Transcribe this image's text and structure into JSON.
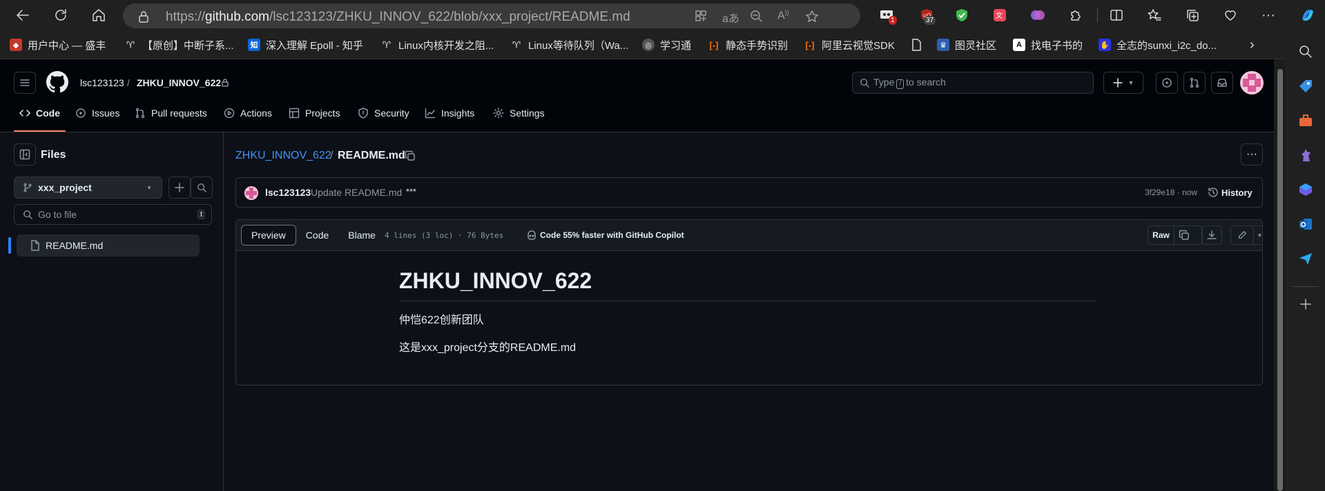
{
  "browser": {
    "url_prefix": "https://",
    "url_domain": "github.com",
    "url_path": "/lsc123123/ZHKU_INNOV_622/blob/xxx_project/README.md",
    "extensions": [
      {
        "icon": "pc-extension-icon",
        "badge": "1",
        "color": "#e5e5e5",
        "badge_color": "#d02020"
      },
      {
        "icon": "ublock-icon",
        "badge": "37",
        "color": "#b3261e",
        "badge_color": "#444444"
      },
      {
        "icon": "shield-check-icon",
        "badge": "",
        "color": "#3fb950"
      },
      {
        "icon": "translate-icon",
        "badge": "",
        "color": "#e8455a"
      },
      {
        "icon": "brain-icon",
        "badge": "",
        "color": "#8a63d2"
      }
    ],
    "bookmarks": [
      {
        "label": "用户中心 — 盛丰",
        "icon": "bookmark-favicon-1",
        "color": "#c0392b"
      },
      {
        "label": "【原创】中断子系...",
        "icon": "wowo-icon",
        "color": "#202020"
      },
      {
        "label": "深入理解 Epoll - 知乎",
        "icon": "zhihu-icon",
        "color": "#0a66d8",
        "glyph": "知"
      },
      {
        "label": "Linux内核开发之阻...",
        "icon": "wowo-icon",
        "color": "#202020"
      },
      {
        "label": "Linux等待队列（Wa...",
        "icon": "wowo-icon",
        "color": "#202020"
      },
      {
        "label": "学习通",
        "icon": "xuexitong-icon",
        "color": "#555555"
      },
      {
        "label": "静态手势识别",
        "icon": "aliyun-icon",
        "color": "#202020"
      },
      {
        "label": "阿里云视觉SDK",
        "icon": "aliyun-icon",
        "color": "#202020"
      },
      {
        "label": "",
        "icon": "page-icon",
        "color": "#202020"
      },
      {
        "label": "图灵社区",
        "icon": "turing-icon",
        "color": "#2d5fb0"
      },
      {
        "label": "找电子书的",
        "icon": "letter-a-icon",
        "color": "#ffffff",
        "glyph": "A"
      },
      {
        "label": "全志的sunxi_i2c_do...",
        "icon": "baidu-icon",
        "color": "#2932e1"
      }
    ]
  },
  "github": {
    "owner": "lsc123123",
    "sep": "/",
    "repo": "ZHKU_INNOV_622",
    "search_prefix": "Type",
    "search_key": "/",
    "search_suffix": "to search",
    "tabs": [
      "Code",
      "Issues",
      "Pull requests",
      "Actions",
      "Projects",
      "Security",
      "Insights",
      "Settings"
    ],
    "sidebar": {
      "title": "Files",
      "branch": "xxx_project",
      "goto_placeholder": "Go to file",
      "goto_key": "t",
      "file": "README.md"
    },
    "path": {
      "repo": "ZHKU_INNOV_622",
      "sep": "/",
      "file": "README.md"
    },
    "commit": {
      "author": "lsc123123",
      "message": "Update README.md",
      "sha_time": "3f29e18 · now",
      "history": "History"
    },
    "file_toolbar": {
      "views": [
        "Preview",
        "Code",
        "Blame"
      ],
      "info": "4 lines (3 loc) · 76 Bytes",
      "copilot": "Code 55% faster with GitHub Copilot",
      "raw": "Raw"
    },
    "readme": {
      "title": "ZHKU_INNOV_622",
      "p1": "仲恺622创新团队",
      "p2": "这是xxx_project分支的README.md"
    }
  },
  "colors": {
    "accent_blue": "#4493f8",
    "tab_underline": "#f78166",
    "sidebar_marker": "#2f81f7"
  }
}
